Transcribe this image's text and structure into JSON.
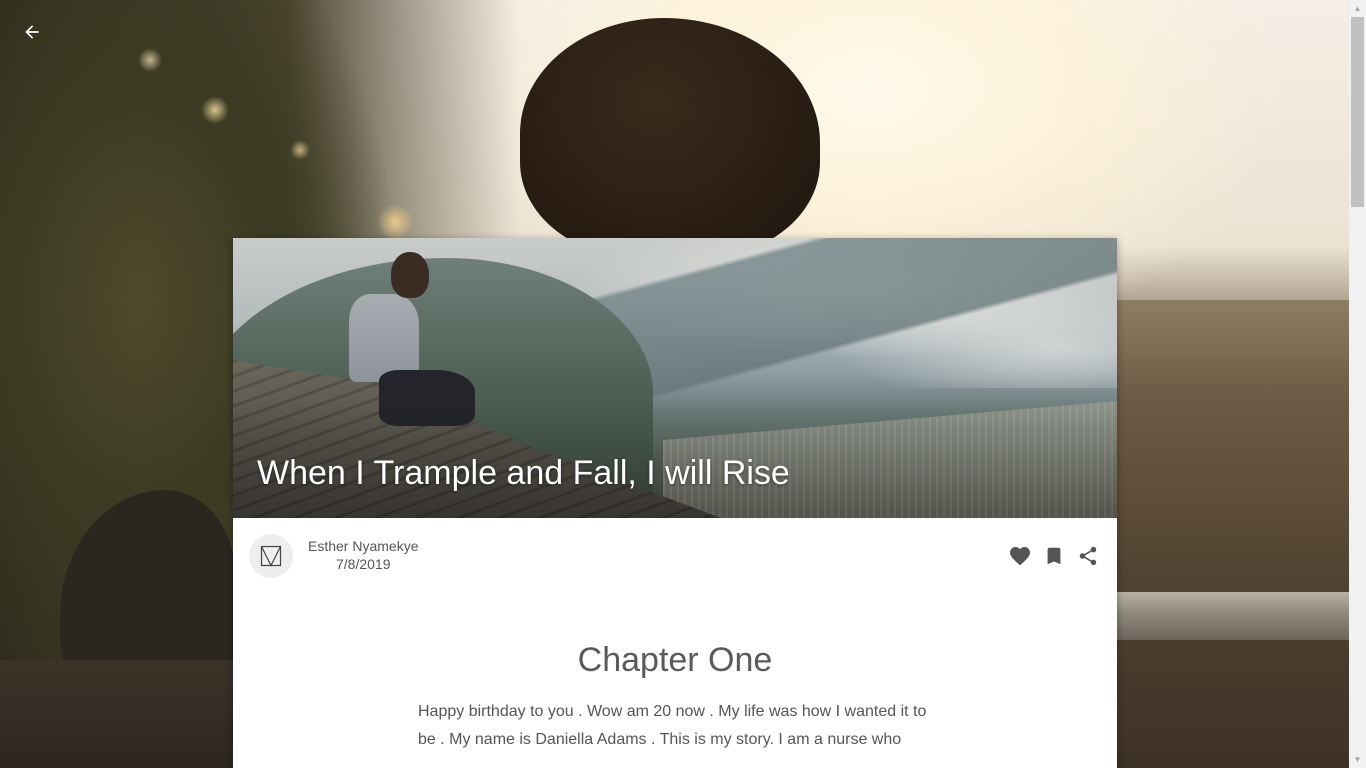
{
  "story": {
    "title": "When I Trample and Fall, I will Rise",
    "author": "Esther Nyamekye",
    "date": "7/8/2019"
  },
  "chapter": {
    "title": "Chapter One",
    "text": "Happy birthday to you . Wow am 20 now . My life was how I wanted it to be . My name is Daniella Adams . This is my story. I am a nurse who studied...",
    "visible_text": "Happy birthday to you . Wow am 20 now . My life was how I wanted it to be . My name is Daniella Adams . This is my story. I am a nurse who"
  },
  "icons": {
    "back": "arrow-left-icon",
    "avatar": "author-logo-icon",
    "like": "heart-icon",
    "bookmark": "bookmark-icon",
    "share": "share-icon"
  },
  "colors": {
    "card_bg": "#ffffff",
    "text": "#555555",
    "icon": "#555555"
  }
}
